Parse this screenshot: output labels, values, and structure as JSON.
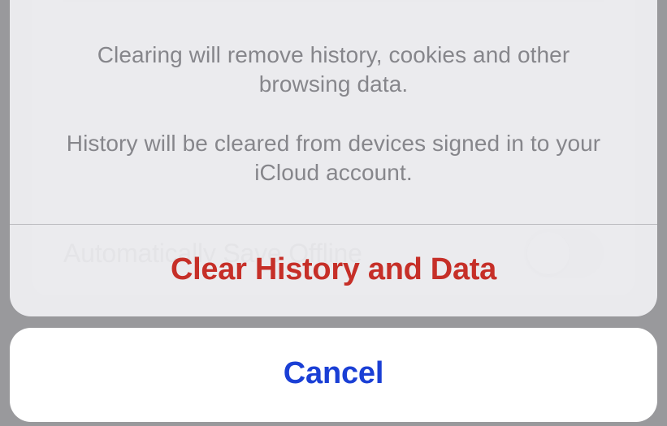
{
  "background": {
    "row_label": "Automatically Save Offline",
    "toggle_on": false
  },
  "action_sheet": {
    "message_line1": "Clearing will remove history, cookies and other browsing data.",
    "message_line2": "History will be cleared from devices signed in to your iCloud account.",
    "destructive_label": "Clear History and Data",
    "cancel_label": "Cancel"
  }
}
